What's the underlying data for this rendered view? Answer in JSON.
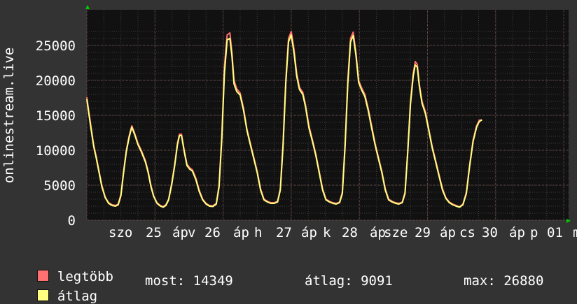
{
  "colors": {
    "background": "#333333",
    "plot_background": "#111111",
    "grid_minor": "#3a3a3a",
    "grid_major": "#6a4a4a",
    "max_series": "#ff7070",
    "avg_series": "#ffff80",
    "axis_arrow": "#00cc00"
  },
  "chart_data": {
    "type": "area",
    "ylabel": "onlinestream.live",
    "y_ticks": [
      0,
      5000,
      10000,
      15000,
      20000,
      25000
    ],
    "ylim": [
      0,
      28000
    ],
    "grid": true,
    "x_ticks": [
      "szo 25 ápr",
      "v 26 ápr",
      "h 27 ápr",
      "k 28 ápr",
      "sze 29 ápr",
      "cs 30 ápr",
      "p 01 m"
    ],
    "x_tick_labels_rendered": [
      "szo",
      "25",
      "áp",
      "v",
      "26",
      "áp",
      "h",
      "27",
      "áp",
      "k",
      "28",
      "áp",
      "sze",
      "29",
      "áp",
      "cs",
      "30",
      "áp",
      "p",
      "01",
      "m"
    ],
    "x_days": [
      0,
      1,
      2,
      3,
      4,
      5,
      6,
      7
    ],
    "series": [
      {
        "name": "legtöbb",
        "color": "#ff7070",
        "points": [
          [
            0,
            17600
          ],
          [
            0.03,
            15500
          ],
          [
            0.06,
            13500
          ],
          [
            0.1,
            10800
          ],
          [
            0.14,
            9000
          ],
          [
            0.18,
            7000
          ],
          [
            0.22,
            5000
          ],
          [
            0.27,
            3300
          ],
          [
            0.32,
            2500
          ],
          [
            0.37,
            2200
          ],
          [
            0.42,
            2100
          ],
          [
            0.46,
            2300
          ],
          [
            0.5,
            3700
          ],
          [
            0.54,
            7000
          ],
          [
            0.58,
            10000
          ],
          [
            0.62,
            12000
          ],
          [
            0.66,
            13500
          ],
          [
            0.7,
            12500
          ],
          [
            0.75,
            11000
          ],
          [
            0.8,
            10000
          ],
          [
            0.86,
            8500
          ],
          [
            0.9,
            7000
          ],
          [
            0.94,
            5000
          ],
          [
            0.98,
            3500
          ],
          [
            1.03,
            2500
          ],
          [
            1.08,
            2100
          ],
          [
            1.12,
            1950
          ],
          [
            1.16,
            2200
          ],
          [
            1.2,
            3000
          ],
          [
            1.25,
            5500
          ],
          [
            1.29,
            8000
          ],
          [
            1.33,
            11000
          ],
          [
            1.36,
            12300
          ],
          [
            1.39,
            12300
          ],
          [
            1.43,
            10000
          ],
          [
            1.47,
            8000
          ],
          [
            1.51,
            7500
          ],
          [
            1.55,
            7200
          ],
          [
            1.6,
            6000
          ],
          [
            1.65,
            4300
          ],
          [
            1.7,
            3000
          ],
          [
            1.75,
            2400
          ],
          [
            1.8,
            2100
          ],
          [
            1.85,
            2050
          ],
          [
            1.9,
            2400
          ],
          [
            1.94,
            5000
          ],
          [
            1.98,
            12000
          ],
          [
            2.02,
            22000
          ],
          [
            2.06,
            26500
          ],
          [
            2.1,
            26800
          ],
          [
            2.13,
            24000
          ],
          [
            2.16,
            20000
          ],
          [
            2.2,
            18800
          ],
          [
            2.25,
            18200
          ],
          [
            2.3,
            16000
          ],
          [
            2.35,
            13000
          ],
          [
            2.4,
            11000
          ],
          [
            2.45,
            9000
          ],
          [
            2.5,
            7000
          ],
          [
            2.55,
            4500
          ],
          [
            2.6,
            3000
          ],
          [
            2.65,
            2700
          ],
          [
            2.7,
            2500
          ],
          [
            2.75,
            2500
          ],
          [
            2.8,
            2700
          ],
          [
            2.84,
            4500
          ],
          [
            2.88,
            11000
          ],
          [
            2.92,
            20000
          ],
          [
            2.96,
            26000
          ],
          [
            3.0,
            27000
          ],
          [
            3.04,
            24500
          ],
          [
            3.08,
            21000
          ],
          [
            3.12,
            19000
          ],
          [
            3.17,
            18300
          ],
          [
            3.21,
            16500
          ],
          [
            3.26,
            13500
          ],
          [
            3.31,
            11500
          ],
          [
            3.36,
            9500
          ],
          [
            3.41,
            7000
          ],
          [
            3.46,
            4500
          ],
          [
            3.51,
            3000
          ],
          [
            3.56,
            2700
          ],
          [
            3.61,
            2500
          ],
          [
            3.66,
            2400
          ],
          [
            3.71,
            2600
          ],
          [
            3.75,
            4000
          ],
          [
            3.79,
            11000
          ],
          [
            3.83,
            20000
          ],
          [
            3.87,
            26000
          ],
          [
            3.91,
            26900
          ],
          [
            3.95,
            24000
          ],
          [
            3.99,
            20000
          ],
          [
            4.03,
            19000
          ],
          [
            4.08,
            18000
          ],
          [
            4.13,
            16000
          ],
          [
            4.18,
            13500
          ],
          [
            4.23,
            11000
          ],
          [
            4.28,
            9000
          ],
          [
            4.33,
            7000
          ],
          [
            4.38,
            4500
          ],
          [
            4.43,
            3000
          ],
          [
            4.48,
            2700
          ],
          [
            4.53,
            2500
          ],
          [
            4.58,
            2400
          ],
          [
            4.63,
            2600
          ],
          [
            4.67,
            4000
          ],
          [
            4.71,
            10000
          ],
          [
            4.75,
            17000
          ],
          [
            4.79,
            21000
          ],
          [
            4.82,
            22700
          ],
          [
            4.85,
            22300
          ],
          [
            4.88,
            19500
          ],
          [
            4.92,
            17000
          ],
          [
            4.97,
            15500
          ],
          [
            5.02,
            13000
          ],
          [
            5.07,
            10500
          ],
          [
            5.12,
            8500
          ],
          [
            5.17,
            6500
          ],
          [
            5.22,
            4500
          ],
          [
            5.27,
            3200
          ],
          [
            5.32,
            2600
          ],
          [
            5.37,
            2300
          ],
          [
            5.42,
            2100
          ],
          [
            5.47,
            1900
          ],
          [
            5.52,
            2300
          ],
          [
            5.57,
            4000
          ],
          [
            5.62,
            8000
          ],
          [
            5.67,
            11500
          ],
          [
            5.72,
            13500
          ],
          [
            5.76,
            14300
          ],
          [
            5.8,
            14349
          ]
        ]
      },
      {
        "name": "átlag",
        "color": "#ffff80",
        "points": [
          [
            0,
            17300
          ],
          [
            0.03,
            15200
          ],
          [
            0.06,
            13200
          ],
          [
            0.1,
            10600
          ],
          [
            0.14,
            8800
          ],
          [
            0.18,
            6800
          ],
          [
            0.22,
            4800
          ],
          [
            0.27,
            3200
          ],
          [
            0.32,
            2400
          ],
          [
            0.37,
            2100
          ],
          [
            0.42,
            2000
          ],
          [
            0.46,
            2200
          ],
          [
            0.5,
            3500
          ],
          [
            0.54,
            6800
          ],
          [
            0.58,
            9800
          ],
          [
            0.62,
            11800
          ],
          [
            0.66,
            13300
          ],
          [
            0.7,
            12300
          ],
          [
            0.75,
            10800
          ],
          [
            0.8,
            9800
          ],
          [
            0.86,
            8300
          ],
          [
            0.9,
            6800
          ],
          [
            0.94,
            4800
          ],
          [
            0.98,
            3400
          ],
          [
            1.03,
            2400
          ],
          [
            1.08,
            2000
          ],
          [
            1.12,
            1850
          ],
          [
            1.16,
            2100
          ],
          [
            1.2,
            2900
          ],
          [
            1.25,
            5300
          ],
          [
            1.29,
            7800
          ],
          [
            1.33,
            10800
          ],
          [
            1.36,
            12100
          ],
          [
            1.39,
            12100
          ],
          [
            1.43,
            9800
          ],
          [
            1.47,
            7800
          ],
          [
            1.51,
            7300
          ],
          [
            1.55,
            7000
          ],
          [
            1.6,
            5800
          ],
          [
            1.65,
            4100
          ],
          [
            1.7,
            2900
          ],
          [
            1.75,
            2300
          ],
          [
            1.8,
            2000
          ],
          [
            1.85,
            1950
          ],
          [
            1.9,
            2300
          ],
          [
            1.94,
            4700
          ],
          [
            1.98,
            11500
          ],
          [
            2.02,
            21000
          ],
          [
            2.06,
            25800
          ],
          [
            2.1,
            26000
          ],
          [
            2.13,
            23500
          ],
          [
            2.16,
            19500
          ],
          [
            2.2,
            18400
          ],
          [
            2.25,
            17900
          ],
          [
            2.3,
            15700
          ],
          [
            2.35,
            12800
          ],
          [
            2.4,
            10800
          ],
          [
            2.45,
            8800
          ],
          [
            2.5,
            6800
          ],
          [
            2.55,
            4300
          ],
          [
            2.6,
            2900
          ],
          [
            2.65,
            2600
          ],
          [
            2.7,
            2400
          ],
          [
            2.75,
            2400
          ],
          [
            2.8,
            2600
          ],
          [
            2.84,
            4300
          ],
          [
            2.88,
            10500
          ],
          [
            2.92,
            19500
          ],
          [
            2.96,
            25500
          ],
          [
            3.0,
            26500
          ],
          [
            3.04,
            24000
          ],
          [
            3.08,
            20600
          ],
          [
            3.12,
            18700
          ],
          [
            3.17,
            18000
          ],
          [
            3.21,
            16200
          ],
          [
            3.26,
            13200
          ],
          [
            3.31,
            11300
          ],
          [
            3.36,
            9300
          ],
          [
            3.41,
            6800
          ],
          [
            3.46,
            4300
          ],
          [
            3.51,
            2900
          ],
          [
            3.56,
            2600
          ],
          [
            3.61,
            2400
          ],
          [
            3.66,
            2300
          ],
          [
            3.71,
            2500
          ],
          [
            3.75,
            3800
          ],
          [
            3.79,
            10500
          ],
          [
            3.83,
            19500
          ],
          [
            3.87,
            25500
          ],
          [
            3.91,
            26400
          ],
          [
            3.95,
            23600
          ],
          [
            3.99,
            19700
          ],
          [
            4.03,
            18700
          ],
          [
            4.08,
            17700
          ],
          [
            4.13,
            15700
          ],
          [
            4.18,
            13200
          ],
          [
            4.23,
            10800
          ],
          [
            4.28,
            8800
          ],
          [
            4.33,
            6800
          ],
          [
            4.38,
            4300
          ],
          [
            4.43,
            2900
          ],
          [
            4.48,
            2600
          ],
          [
            4.53,
            2400
          ],
          [
            4.58,
            2300
          ],
          [
            4.63,
            2500
          ],
          [
            4.67,
            3800
          ],
          [
            4.71,
            9700
          ],
          [
            4.75,
            16600
          ],
          [
            4.79,
            20600
          ],
          [
            4.82,
            22200
          ],
          [
            4.85,
            21900
          ],
          [
            4.88,
            19200
          ],
          [
            4.92,
            16700
          ],
          [
            4.97,
            15200
          ],
          [
            5.02,
            12800
          ],
          [
            5.07,
            10300
          ],
          [
            5.12,
            8300
          ],
          [
            5.17,
            6300
          ],
          [
            5.22,
            4300
          ],
          [
            5.27,
            3100
          ],
          [
            5.32,
            2500
          ],
          [
            5.37,
            2200
          ],
          [
            5.42,
            2000
          ],
          [
            5.47,
            1850
          ],
          [
            5.52,
            2200
          ],
          [
            5.57,
            3800
          ],
          [
            5.62,
            7800
          ],
          [
            5.67,
            11300
          ],
          [
            5.72,
            13300
          ],
          [
            5.76,
            14100
          ],
          [
            5.8,
            14349
          ]
        ]
      }
    ]
  },
  "legend": {
    "max_label": "legtöbb",
    "avg_label": "átlag",
    "now_text": "most: 14349",
    "avg_text": "átlag: 9091",
    "max_text": "max: 26880"
  }
}
